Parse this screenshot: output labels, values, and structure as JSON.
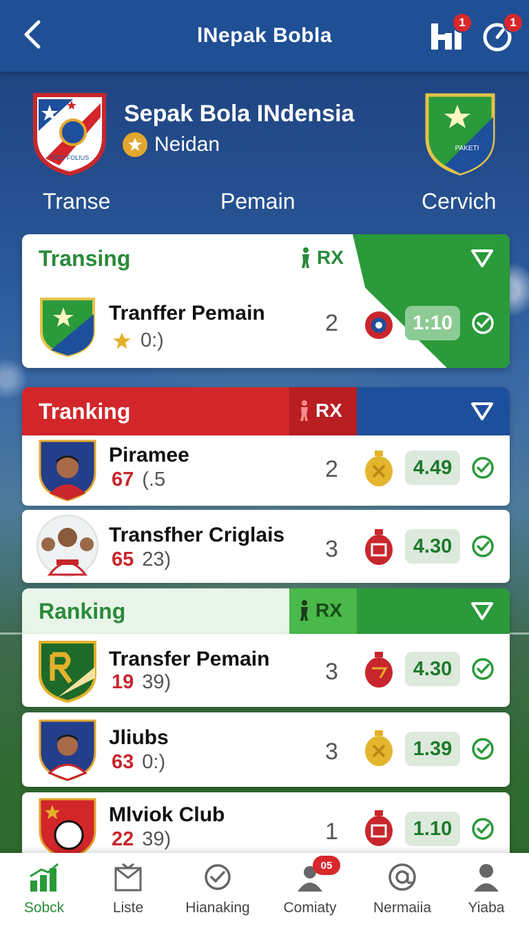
{
  "header": {
    "title": "lNepak Bobla",
    "stats_badge": "1",
    "timer_badge": "1"
  },
  "club": {
    "name": "Sepak Bola INdensia",
    "subtitle": "Neidan",
    "logo_left_text": "TICO FOLIUS",
    "logo_right_text": "PAKETI",
    "tabs": [
      "Transe",
      "Pemain",
      "Cervich"
    ]
  },
  "sections": [
    {
      "title": "Transing",
      "rx_label": "RX",
      "rows": [
        {
          "name": "Tranffer Pemain",
          "score": "",
          "detail": "0:)",
          "count": "2",
          "odds": "1:10"
        }
      ]
    },
    {
      "title": "Tranking",
      "rx_label": "RX",
      "rows": [
        {
          "name": "Piramee",
          "score": "67",
          "detail": "(.5",
          "count": "2",
          "odds": "4.49"
        },
        {
          "name": "Transfher Criglais",
          "score": "65",
          "detail": "23)",
          "count": "3",
          "odds": "4.30"
        }
      ]
    },
    {
      "title": "Ranking",
      "rx_label": "RX",
      "rows": [
        {
          "name": "Transfer Pemain",
          "score": "19",
          "detail": "39)",
          "count": "3",
          "odds": "4.30"
        },
        {
          "name": "Jliubs",
          "score": "63",
          "detail": "0:)",
          "count": "3",
          "odds": "1.39"
        },
        {
          "name": "Mlviok Club",
          "score": "22",
          "detail": "39)",
          "count": "1",
          "odds": "1.10"
        }
      ]
    }
  ],
  "nav": [
    {
      "label": "Sobck",
      "icon": "chart-icon"
    },
    {
      "label": "Liste",
      "icon": "list-icon"
    },
    {
      "label": "Hianaking",
      "icon": "check-circle-icon"
    },
    {
      "label": "Comiaty",
      "icon": "users-icon",
      "badge": "05"
    },
    {
      "label": "Nermaiia",
      "icon": "at-icon"
    },
    {
      "label": "Yiaba",
      "icon": "profile-icon"
    }
  ],
  "colors": {
    "topbar": "#1f4f95",
    "green": "#2a9a3a",
    "red": "#d2262a",
    "blue": "#1e4f9c",
    "odds_bg": "#dce9dc"
  }
}
